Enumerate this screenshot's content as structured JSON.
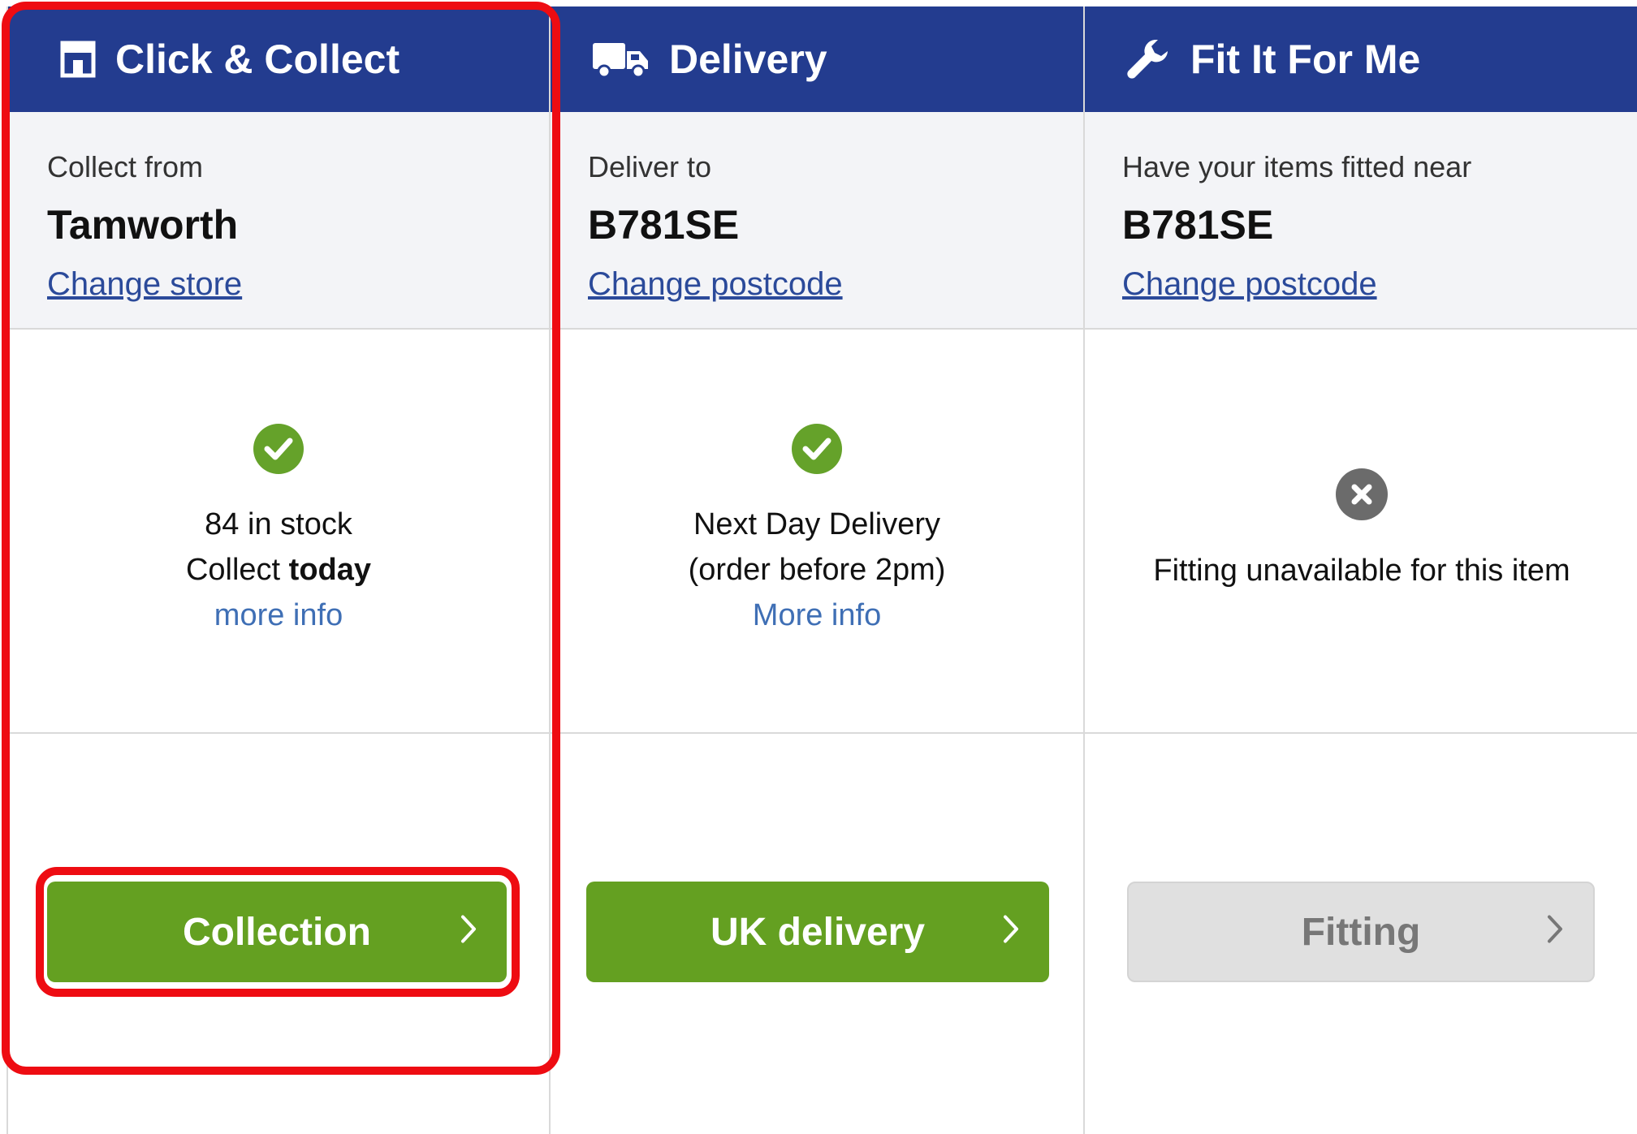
{
  "columns": [
    {
      "title": "Click & Collect",
      "icon": "store-icon",
      "location_label": "Collect from",
      "location_value": "Tamworth",
      "change_link": "Change store",
      "status_icon": "check-circle-icon",
      "status_line1": "84 in stock",
      "status_line2_prefix": "Collect ",
      "status_line2_bold": "today",
      "more_info": "more info",
      "button_label": "Collection",
      "button_enabled": true
    },
    {
      "title": "Delivery",
      "icon": "truck-icon",
      "location_label": "Deliver to",
      "location_value": "B781SE",
      "change_link": "Change postcode",
      "status_icon": "check-circle-icon",
      "status_line1": "Next Day Delivery",
      "status_line2": "(order before 2pm)",
      "more_info": "More info",
      "button_label": "UK delivery",
      "button_enabled": true
    },
    {
      "title": "Fit It For Me",
      "icon": "wrench-icon",
      "location_label": "Have your items fitted near",
      "location_value": "B781SE",
      "change_link": "Change postcode",
      "status_icon": "x-circle-icon",
      "status_line1": "Fitting unavailable for this item",
      "button_label": "Fitting",
      "button_enabled": false
    }
  ],
  "colors": {
    "header_bg": "#233c8f",
    "location_bg": "#f3f4f7",
    "button_green": "#64a021",
    "button_disabled": "#e0e0e0",
    "check_green": "#65a22a",
    "link_blue": "#2b4a9a",
    "highlight_red": "#ee0c12"
  }
}
